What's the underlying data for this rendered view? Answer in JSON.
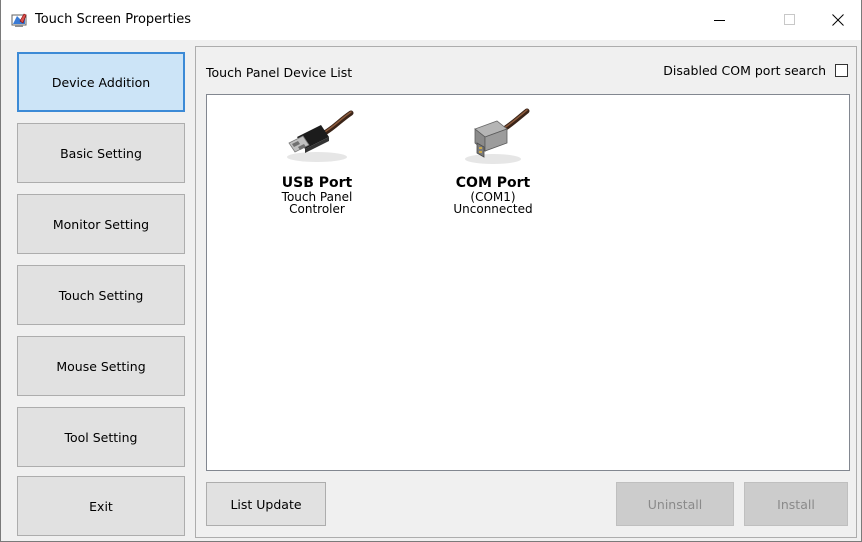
{
  "window": {
    "title": "Touch Screen Properties"
  },
  "sidebar": {
    "items": [
      {
        "label": "Device Addition",
        "active": true
      },
      {
        "label": "Basic Setting"
      },
      {
        "label": "Monitor Setting"
      },
      {
        "label": "Touch Setting"
      },
      {
        "label": "Mouse Setting"
      },
      {
        "label": "Tool Setting"
      },
      {
        "label": "Exit"
      }
    ]
  },
  "main": {
    "list_label": "Touch Panel Device List",
    "com_search_label": "Disabled COM port search",
    "com_search_checked": false,
    "devices": [
      {
        "icon": "usb-plug-icon",
        "title": "USB Port",
        "line1": "Touch Panel",
        "line2": "Controler"
      },
      {
        "icon": "serial-plug-icon",
        "title": "COM Port",
        "line1": "(COM1)",
        "line2": "Unconnected"
      }
    ],
    "buttons": {
      "list_update": "List Update",
      "uninstall": "Uninstall",
      "install": "Install"
    }
  },
  "colors": {
    "active_tab_bg": "#cce4f7",
    "active_tab_border": "#3c8ad6",
    "button_bg": "#e1e1e1",
    "disabled_bg": "#cccccc"
  }
}
